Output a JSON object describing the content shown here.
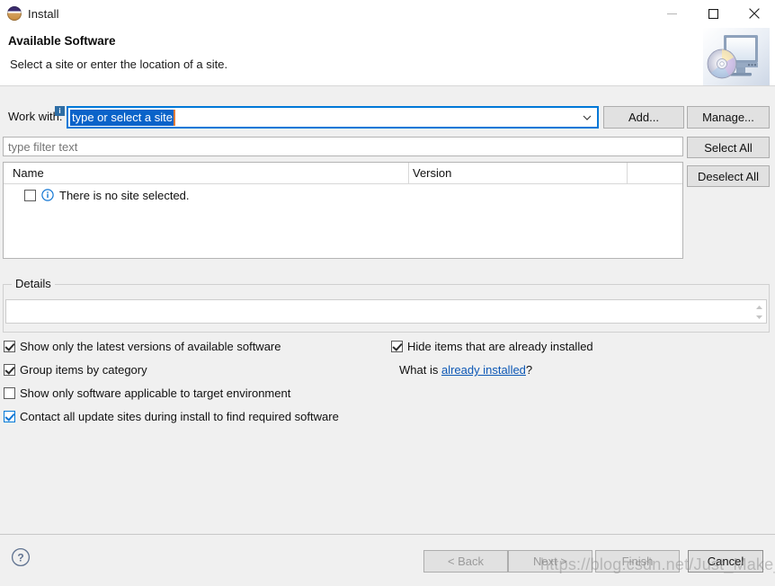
{
  "window": {
    "title": "Install",
    "app_icon": "eclipse-icon",
    "controls": {
      "minimize": "minimize-icon",
      "maximize": "maximize-icon",
      "close": "close-icon"
    }
  },
  "header": {
    "title": "Available Software",
    "subtitle": "Select a site or enter the location of a site.",
    "banner_icon": "install-monitor-disc-icon"
  },
  "work_with": {
    "label": "Work with:",
    "badge": "i",
    "value": "type or select a site",
    "placeholder": "type or select a site",
    "dropdown_icon": "chevron-down-icon",
    "add_label": "Add...",
    "manage_label": "Manage..."
  },
  "filter": {
    "placeholder": "type filter text",
    "value": ""
  },
  "list_actions": {
    "select_all": "Select All",
    "deselect_all": "Deselect All"
  },
  "table": {
    "columns": [
      "Name",
      "Version"
    ],
    "rows": [
      {
        "checked": false,
        "icon": "info-circle-icon",
        "name": "There is no site selected.",
        "version": ""
      }
    ]
  },
  "details": {
    "legend": "Details",
    "content": "",
    "scroll_up_icon": "triangle-up-icon",
    "scroll_down_icon": "triangle-down-icon"
  },
  "options": {
    "left": [
      {
        "label": "Show only the latest versions of available software",
        "checked": true,
        "accent": false
      },
      {
        "label": "Group items by category",
        "checked": true,
        "accent": false
      },
      {
        "label": "Show only software applicable to target environment",
        "checked": false,
        "accent": false
      },
      {
        "label": "Contact all update sites during install to find required software",
        "checked": true,
        "accent": true
      }
    ],
    "right": [
      {
        "label": "Hide items that are already installed",
        "checked": true,
        "accent": false
      }
    ],
    "whatis_prefix": "What is ",
    "whatis_link": "already installed",
    "whatis_suffix": "?"
  },
  "footer": {
    "help_icon": "help-circle-icon",
    "back_label": "< Back",
    "next_label": "Next >",
    "finish_label": "Finish",
    "cancel_label": "Cancel"
  },
  "watermark": {
    "text": "https://blog.csdn.net/Just_Make_It"
  },
  "colors": {
    "accent": "#0078d7",
    "selection": "#0a63c9",
    "caret": "#e07b39",
    "link": "#0b57b5",
    "info": "#1477d4"
  }
}
